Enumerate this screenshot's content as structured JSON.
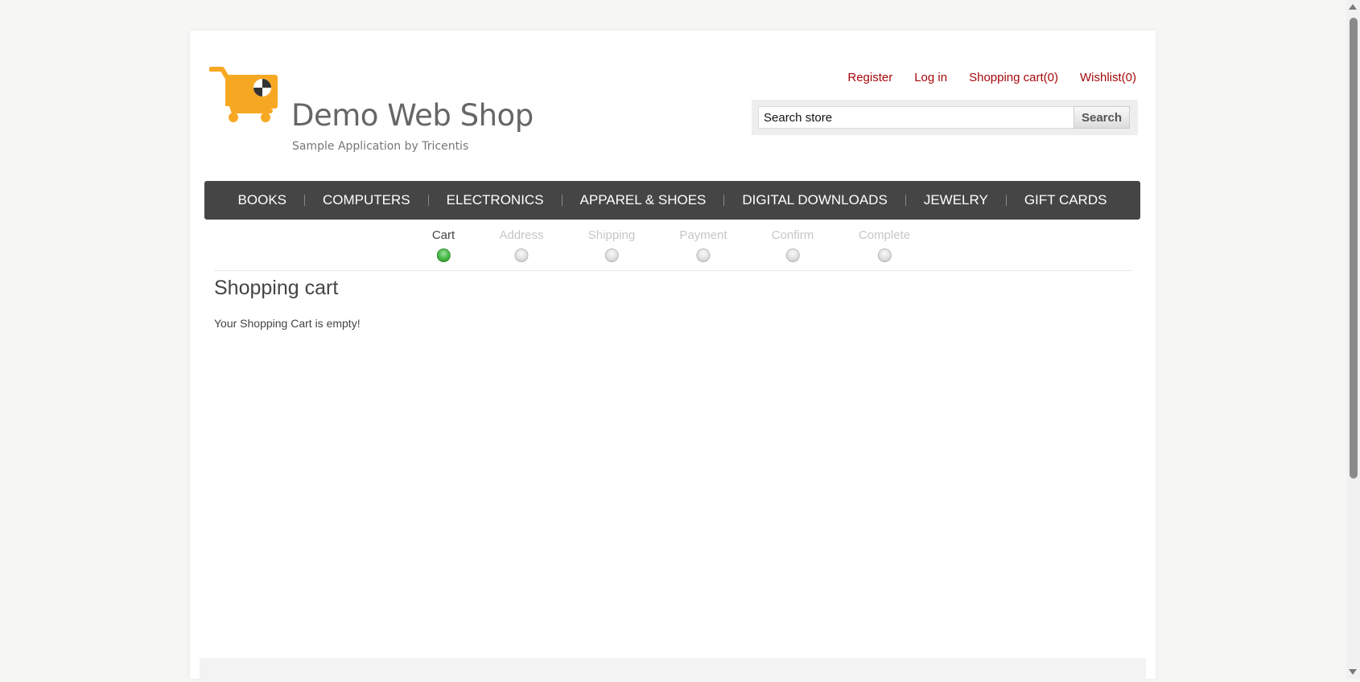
{
  "header": {
    "logo_title": "Demo Web Shop",
    "logo_subtitle": "Sample Application by Tricentis",
    "links": {
      "register": "Register",
      "login": "Log in",
      "cart": "Shopping cart(0)",
      "wishlist": "Wishlist(0)"
    },
    "search": {
      "placeholder": "Search store",
      "button": "Search"
    }
  },
  "menu": {
    "items": [
      "BOOKS",
      "COMPUTERS",
      "ELECTRONICS",
      "APPAREL & SHOES",
      "DIGITAL DOWNLOADS",
      "JEWELRY",
      "GIFT CARDS"
    ]
  },
  "progress": {
    "steps": [
      "Cart",
      "Address",
      "Shipping",
      "Payment",
      "Confirm",
      "Complete"
    ],
    "active": "Cart"
  },
  "main": {
    "title": "Shopping cart",
    "empty_message": "Your Shopping Cart is empty!"
  },
  "colors": {
    "link": "#a6080b",
    "menu_bg": "#454545",
    "logo_orange": "#f7a823",
    "active_step": "#43b743"
  }
}
